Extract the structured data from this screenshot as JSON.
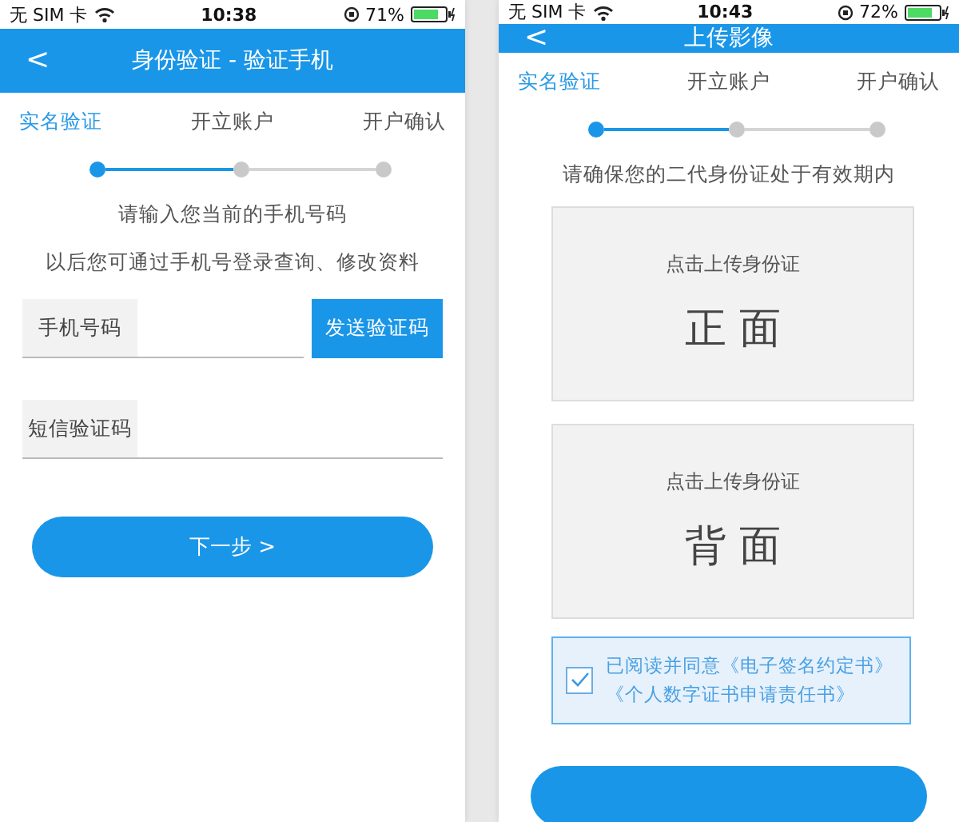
{
  "screens": [
    {
      "kind": "phone_verify",
      "status_bar": {
        "carrier": "无 SIM 卡",
        "time": "10:38",
        "battery": "71%"
      },
      "nav": {
        "back": "<",
        "title": "身份验证 - 验证手机"
      },
      "steps": [
        {
          "label": "实名验证",
          "selected": true
        },
        {
          "label": "开立账户",
          "selected": false
        },
        {
          "label": "开户确认",
          "selected": false
        }
      ],
      "intro": [
        "请输入您当前的手机号码",
        "以后您可通过手机号登录查询、修改资料"
      ],
      "fields": [
        {
          "label": "手机号码",
          "action": "发送验证码"
        },
        {
          "label": "短信验证码"
        }
      ],
      "next_button": "下一步 >"
    },
    {
      "kind": "upload",
      "status_bar": {
        "carrier": "无 SIM 卡",
        "time": "10:43",
        "battery": "72%"
      },
      "nav": {
        "back": "<",
        "title": "上传影像"
      },
      "steps": [
        {
          "label": "实名验证",
          "selected": true
        },
        {
          "label": "开立账户",
          "selected": false
        },
        {
          "label": "开户确认",
          "selected": false
        }
      ],
      "notice": "请确保您的二代身份证处于有效期内",
      "cards": [
        {
          "hint": "点击上传身份证",
          "side": "正 面"
        },
        {
          "hint": "点击上传身份证",
          "side": "背 面"
        }
      ],
      "agreement": {
        "checked": true,
        "text": "已阅读并同意《电子签名约定书》《个人数字证书申请责任书》"
      }
    }
  ]
}
